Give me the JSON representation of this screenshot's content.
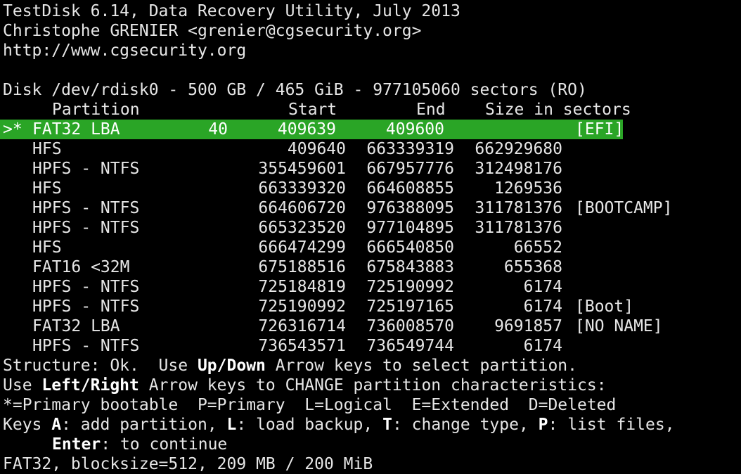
{
  "header": {
    "title_line": "TestDisk 6.14, Data Recovery Utility, July 2013",
    "author_line": "Christophe GRENIER <grenier@cgsecurity.org>",
    "url_line": "http://www.cgsecurity.org"
  },
  "disk": {
    "info_line": "Disk /dev/rdisk0 - 500 GB / 465 GiB - 977105060 sectors (RO)"
  },
  "columns": {
    "partition": "Partition",
    "start": "Start",
    "end": "End",
    "size": "Size in sectors"
  },
  "partitions": [
    {
      "marker": ">*",
      "type": "FAT32 LBA",
      "start": "40",
      "end": "409639",
      "size": "409600",
      "label": "[EFI]"
    },
    {
      "marker": "",
      "type": "HFS",
      "start": "409640",
      "end": "663339319",
      "size": "662929680",
      "label": ""
    },
    {
      "marker": "",
      "type": "HPFS - NTFS",
      "start": "355459601",
      "end": "667957776",
      "size": "312498176",
      "label": ""
    },
    {
      "marker": "",
      "type": "HFS",
      "start": "663339320",
      "end": "664608855",
      "size": "1269536",
      "label": ""
    },
    {
      "marker": "",
      "type": "HPFS - NTFS",
      "start": "664606720",
      "end": "976388095",
      "size": "311781376",
      "label": "[BOOTCAMP]"
    },
    {
      "marker": "",
      "type": "HPFS - NTFS",
      "start": "665323520",
      "end": "977104895",
      "size": "311781376",
      "label": ""
    },
    {
      "marker": "",
      "type": "HFS",
      "start": "666474299",
      "end": "666540850",
      "size": "66552",
      "label": ""
    },
    {
      "marker": "",
      "type": "FAT16 <32M",
      "start": "675188516",
      "end": "675843883",
      "size": "655368",
      "label": ""
    },
    {
      "marker": "",
      "type": "HPFS - NTFS",
      "start": "725184819",
      "end": "725190992",
      "size": "6174",
      "label": ""
    },
    {
      "marker": "",
      "type": "HPFS - NTFS",
      "start": "725190992",
      "end": "725197165",
      "size": "6174",
      "label": "[Boot]"
    },
    {
      "marker": "",
      "type": "FAT32 LBA",
      "start": "726316714",
      "end": "736008570",
      "size": "9691857",
      "label": "[NO NAME]"
    },
    {
      "marker": "",
      "type": "HPFS - NTFS",
      "start": "736543571",
      "end": "736549744",
      "size": "6174",
      "label": ""
    }
  ],
  "help": {
    "line1_prefix": "Structure: Ok.  Use ",
    "line1_key": "Up/Down",
    "line1_suffix": " Arrow keys to select partition.",
    "line2_prefix": "Use ",
    "line2_key": "Left/Right",
    "line2_suffix": " Arrow keys to CHANGE partition characteristics:",
    "line3": "*=Primary bootable  P=Primary  L=Logical  E=Extended  D=Deleted",
    "line4_keys_label": "Keys ",
    "line4_a": "A",
    "line4_a_text": ": add partition, ",
    "line4_l": "L",
    "line4_l_text": ": load backup, ",
    "line4_t": "T",
    "line4_t_text": ": change type, ",
    "line4_p": "P",
    "line4_p_text": ": list files,",
    "line5_enter": "Enter",
    "line5_text": ": to continue"
  },
  "status": {
    "line": "FAT32, blocksize=512, 209 MB / 200 MiB"
  },
  "colors": {
    "background": "#000000",
    "foreground": "#e6e6e6",
    "selection": "#2aa526"
  }
}
